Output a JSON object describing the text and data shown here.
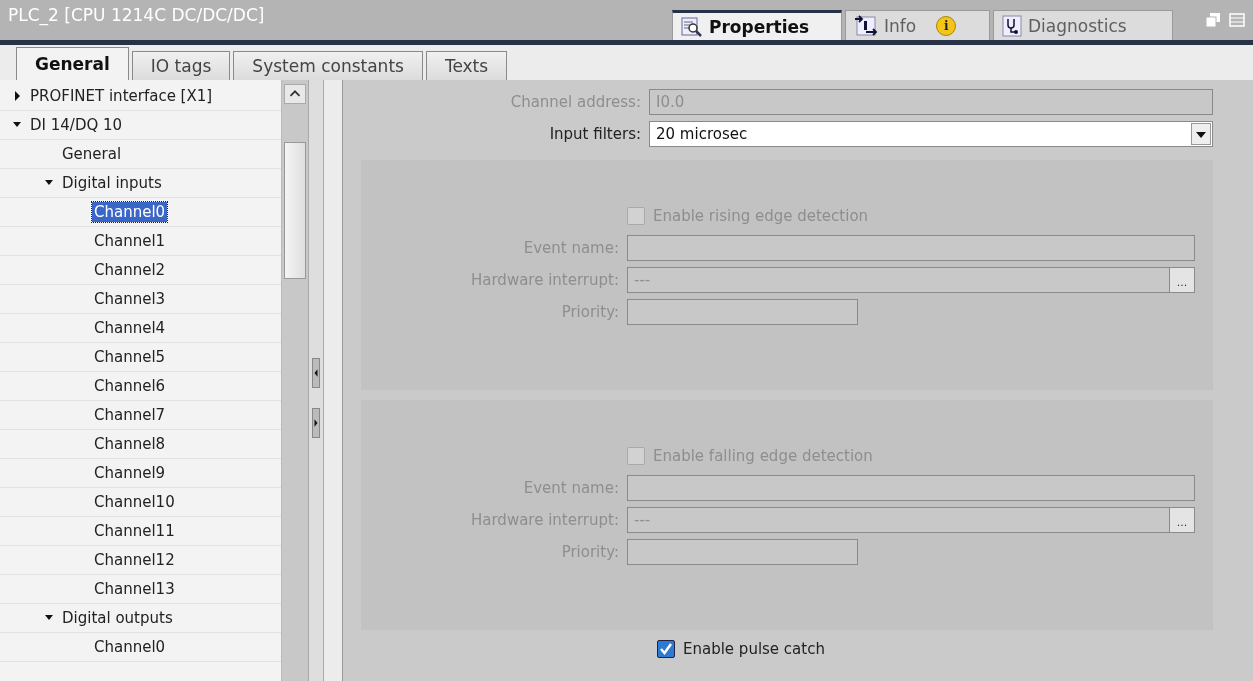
{
  "title": "PLC_2 [CPU 1214C DC/DC/DC]",
  "inspector_tabs": [
    {
      "kind": "properties",
      "label": "Properties",
      "selected": true
    },
    {
      "kind": "info",
      "label": "Info",
      "selected": false,
      "badge": "i"
    },
    {
      "kind": "diagnostics",
      "label": "Diagnostics",
      "selected": false
    }
  ],
  "tabs": [
    {
      "label": "General",
      "selected": true
    },
    {
      "label": "IO tags",
      "selected": false
    },
    {
      "label": "System constants",
      "selected": false
    },
    {
      "label": "Texts",
      "selected": false
    }
  ],
  "tree": [
    {
      "label": "PROFINET interface [X1]",
      "expanded": false,
      "selected": false
    },
    {
      "label": "DI 14/DQ 10",
      "expanded": true,
      "selected": false,
      "children": [
        {
          "label": "General",
          "selected": false
        },
        {
          "label": "Digital inputs",
          "expanded": true,
          "selected": false,
          "children": [
            {
              "label": "Channel0",
              "selected": true
            },
            {
              "label": "Channel1",
              "selected": false
            },
            {
              "label": "Channel2",
              "selected": false
            },
            {
              "label": "Channel3",
              "selected": false
            },
            {
              "label": "Channel4",
              "selected": false
            },
            {
              "label": "Channel5",
              "selected": false
            },
            {
              "label": "Channel6",
              "selected": false
            },
            {
              "label": "Channel7",
              "selected": false
            },
            {
              "label": "Channel8",
              "selected": false
            },
            {
              "label": "Channel9",
              "selected": false
            },
            {
              "label": "Channel10",
              "selected": false
            },
            {
              "label": "Channel11",
              "selected": false
            },
            {
              "label": "Channel12",
              "selected": false
            },
            {
              "label": "Channel13",
              "selected": false
            }
          ]
        },
        {
          "label": "Digital outputs",
          "expanded": true,
          "selected": false,
          "children": [
            {
              "label": "Channel0",
              "selected": false
            }
          ]
        }
      ]
    }
  ],
  "channel_address": {
    "label": "Channel address:",
    "value": "I0.0",
    "disabled": true
  },
  "input_filters": {
    "label": "Input filters:",
    "value": "20 microsec",
    "disabled": false
  },
  "groups": [
    {
      "checkbox": {
        "label": "Enable rising edge detection",
        "checked": false,
        "disabled": true
      },
      "event_name": {
        "label": "Event name:",
        "disabled": true
      },
      "hardware_interrupt": {
        "label": "Hardware interrupt:",
        "value": "---",
        "button": "...",
        "disabled": true
      },
      "priority": {
        "label": "Priority:",
        "disabled": true
      }
    },
    {
      "checkbox": {
        "label": "Enable falling edge detection",
        "checked": false,
        "disabled": true
      },
      "event_name": {
        "label": "Event name:",
        "disabled": true
      },
      "hardware_interrupt": {
        "label": "Hardware interrupt:",
        "value": "---",
        "button": "...",
        "disabled": true
      },
      "priority": {
        "label": "Priority:",
        "disabled": true
      }
    }
  ],
  "pulse_catch": {
    "label": "Enable pulse catch",
    "checked": true,
    "disabled": false
  }
}
